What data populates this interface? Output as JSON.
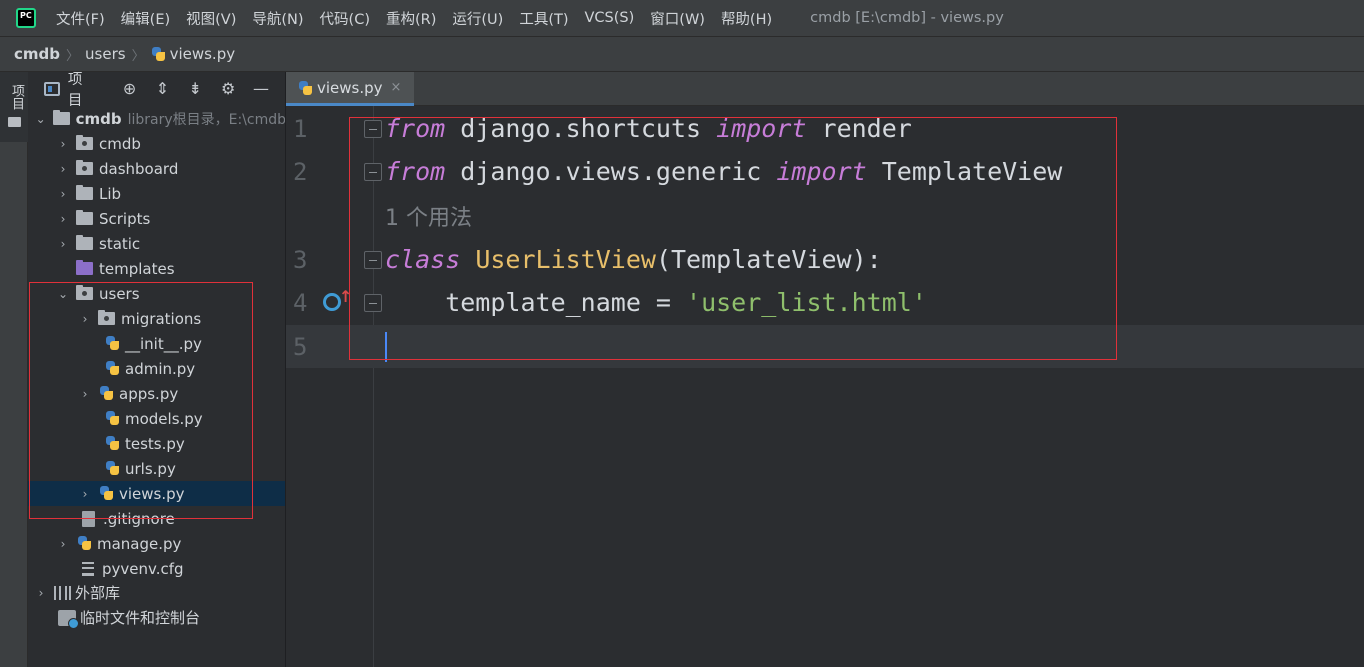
{
  "menubar": {
    "logo_text": "PC",
    "items": [
      "文件(F)",
      "编辑(E)",
      "视图(V)",
      "导航(N)",
      "代码(C)",
      "重构(R)",
      "运行(U)",
      "工具(T)",
      "VCS(S)",
      "窗口(W)",
      "帮助(H)"
    ],
    "window_title": "cmdb [E:\\cmdb] - views.py"
  },
  "breadcrumb": {
    "items": [
      "cmdb",
      "users",
      "views.py"
    ],
    "separator": "〉"
  },
  "toolstrip": {
    "project_tab": "项目"
  },
  "project": {
    "header_label": "项目",
    "root": {
      "name": "cmdb",
      "hint": "library根目录，E:\\cmdb"
    },
    "items": [
      {
        "label": "cmdb"
      },
      {
        "label": "dashboard"
      },
      {
        "label": "Lib"
      },
      {
        "label": "Scripts"
      },
      {
        "label": "static"
      },
      {
        "label": "templates"
      },
      {
        "label": "users"
      },
      {
        "label": "migrations"
      },
      {
        "label": "__init__.py"
      },
      {
        "label": "admin.py"
      },
      {
        "label": "apps.py"
      },
      {
        "label": "models.py"
      },
      {
        "label": "tests.py"
      },
      {
        "label": "urls.py"
      },
      {
        "label": "views.py"
      },
      {
        "label": ".gitignore"
      },
      {
        "label": "manage.py"
      },
      {
        "label": "pyvenv.cfg"
      },
      {
        "label": "外部库"
      },
      {
        "label": "临时文件和控制台"
      }
    ]
  },
  "editor": {
    "tab_label": "views.py",
    "tab_close": "×",
    "line_numbers": [
      "1",
      "2",
      "3",
      "4",
      "5"
    ],
    "line1": {
      "kw1": "from",
      "mod": " django.shortcuts ",
      "kw2": "import",
      "name": " render"
    },
    "line2": {
      "kw1": "from",
      "mod": " django.views.generic ",
      "kw2": "import",
      "name": " TemplateView"
    },
    "usage_hint": "1 个用法",
    "line3": {
      "kw": "class",
      "cls": " UserListView",
      "rest": "(TemplateView):"
    },
    "line4": {
      "indent": "    template_name = ",
      "str": "'user_list.html'"
    },
    "override_marker": "↑"
  },
  "colors": {
    "keyword": "#c77dd8",
    "class_name": "#e8bf6a",
    "string": "#8fbf6c",
    "selection": "#0e2d47",
    "highlight_box": "#e0313a"
  }
}
